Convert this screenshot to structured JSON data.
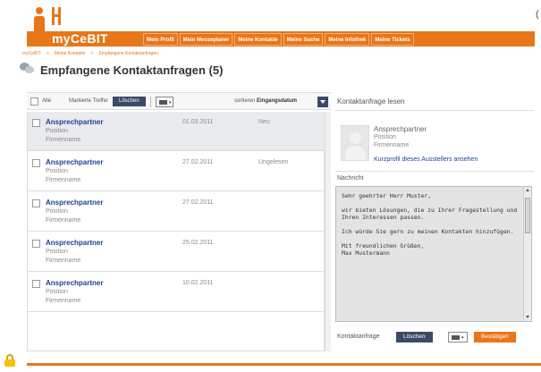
{
  "brand": {
    "name": "myCeBIT",
    "accent": "#e8761a"
  },
  "nav": {
    "tabs": [
      "Mein Profil",
      "Mein Messeplaner",
      "Meine Kontakte",
      "Meine Suche",
      "Meine Infothek",
      "Meine Tickets"
    ]
  },
  "breadcrumb": [
    "myCeBIT",
    "Meine Kontakte",
    "Empfangene Kontaktanfragen"
  ],
  "page": {
    "title": "Empfangene Kontaktanfragen (5)"
  },
  "list_toolbar": {
    "all_label": "Alle",
    "marked_label": "Markierte Treffer",
    "delete_label": "Löschen",
    "sort_label": "sortieren",
    "sort_value": "Eingangsdatum"
  },
  "messages": [
    {
      "name": "Ansprechpartner",
      "position": "Position",
      "company": "Firmenname",
      "date": "01.03.2011",
      "status": "Neu",
      "selected": true
    },
    {
      "name": "Ansprechpartner",
      "position": "Position",
      "company": "Firmenname",
      "date": "27.02.2011",
      "status": "Ungelesen",
      "selected": false
    },
    {
      "name": "Ansprechpartner",
      "position": "Position",
      "company": "Firmenname",
      "date": "27.02.2011",
      "status": "",
      "selected": false
    },
    {
      "name": "Ansprechpartner",
      "position": "Position",
      "company": "Firmenname",
      "date": "25.02.2011",
      "status": "",
      "selected": false
    },
    {
      "name": "Ansprechpartner",
      "position": "Position",
      "company": "Firmenname",
      "date": "10.02.2011",
      "status": "",
      "selected": false
    }
  ],
  "detail": {
    "title": "Kontaktanfrage lesen",
    "name": "Ansprechpartner",
    "position": "Position",
    "company": "Firmenname",
    "profile_link": "Kurzprofil dieses Ausstellers ansehen",
    "message_label": "Nachricht",
    "message_text": "Sehr geehrter Herr Muster,\n\nwir bieten Lösungen, die zu Ihrer Fragestellung und Ihren Interessen passen.\n\nIch würde Sie gern zu meinen Kontakten hinzufügen.\n\nMit freundlichen Grüßen,\nMax Mustermann",
    "action_label": "Kontaktanfrage",
    "delete_label": "Löschen",
    "confirm_label": "Bestätigen"
  },
  "icons": [
    "logo-icon",
    "contacts-icon",
    "print-icon",
    "chevron-down-icon",
    "avatar-icon",
    "lock-icon"
  ],
  "colors": {
    "accent": "#e8761a",
    "button_dark": "#3b4a66",
    "link": "#22409a"
  }
}
